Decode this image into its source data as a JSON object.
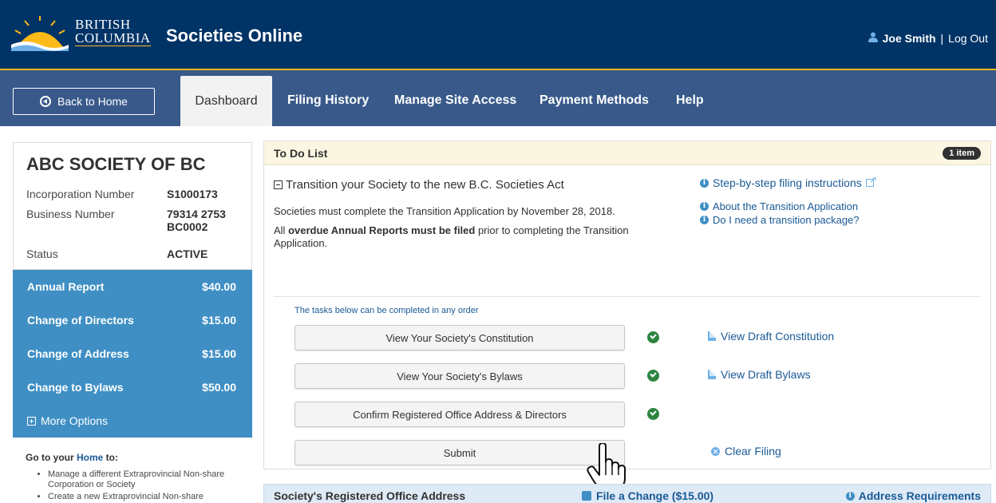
{
  "header": {
    "logo_line1": "BRITISH",
    "logo_line2": "COLUMBIA",
    "app_title": "Societies Online",
    "user_name": "Joe Smith",
    "separator": "|",
    "logout": "Log Out"
  },
  "nav": {
    "back_label": "Back to Home",
    "tabs": [
      "Dashboard",
      "Filing History",
      "Manage Site Access",
      "Payment Methods",
      "Help"
    ],
    "active_tab": "Dashboard"
  },
  "sidebar": {
    "org_name": "ABC SOCIETY OF BC",
    "incorporation_label": "Incorporation Number",
    "incorporation_value": "S1000173",
    "business_label": "Business Number",
    "business_value_1": "79314 2753",
    "business_value_2": "BC0002",
    "status_label": "Status",
    "status_value": "ACTIVE",
    "fees": [
      {
        "label": "Annual Report",
        "amount": "$40.00"
      },
      {
        "label": "Change of Directors",
        "amount": "$15.00"
      },
      {
        "label": "Change of Address",
        "amount": "$15.00"
      },
      {
        "label": "Change to Bylaws",
        "amount": "$50.00"
      }
    ],
    "more_options": "More Options",
    "goto_prefix": "Go to your ",
    "goto_home": "Home",
    "goto_suffix": " to:",
    "goto_items": [
      "Manage a different Extraprovincial Non-share Corporation or Society",
      "Create a new Extraprovincial Non-share"
    ]
  },
  "todo": {
    "title": "To Do List",
    "badge": "1 item",
    "task_title": "Transition your Society to the new B.C. Societies Act",
    "desc1": "Societies must complete the Transition Application by November 28, 2018.",
    "desc2_pre": "All ",
    "desc2_bold": "overdue Annual Reports must be filed",
    "desc2_post": " prior to completing the Transition Application.",
    "link_instructions": "Step-by-step filing instructions",
    "link_about": "About the Transition Application",
    "link_package": "Do I need a transition package?",
    "order_note": "The tasks below can be completed in any order",
    "buttons": [
      "View Your Society's Constitution",
      "View Your Society's Bylaws",
      "Confirm Registered Office Address & Directors",
      "Submit"
    ],
    "draft_constitution": "View Draft Constitution",
    "draft_bylaws": "View Draft Bylaws",
    "clear_filing": "Clear Filing"
  },
  "address_section": {
    "title": "Society's Registered Office Address",
    "file_change": "File a Change ($15.00)",
    "requirements": "Address Requirements"
  },
  "colors": {
    "header_bg": "#003366",
    "nav_bg": "#38598a",
    "accent_gold": "#fcba19",
    "sidebar_blue": "#3f8fc4",
    "link_blue": "#1a5a96",
    "check_green": "#2e8540"
  }
}
